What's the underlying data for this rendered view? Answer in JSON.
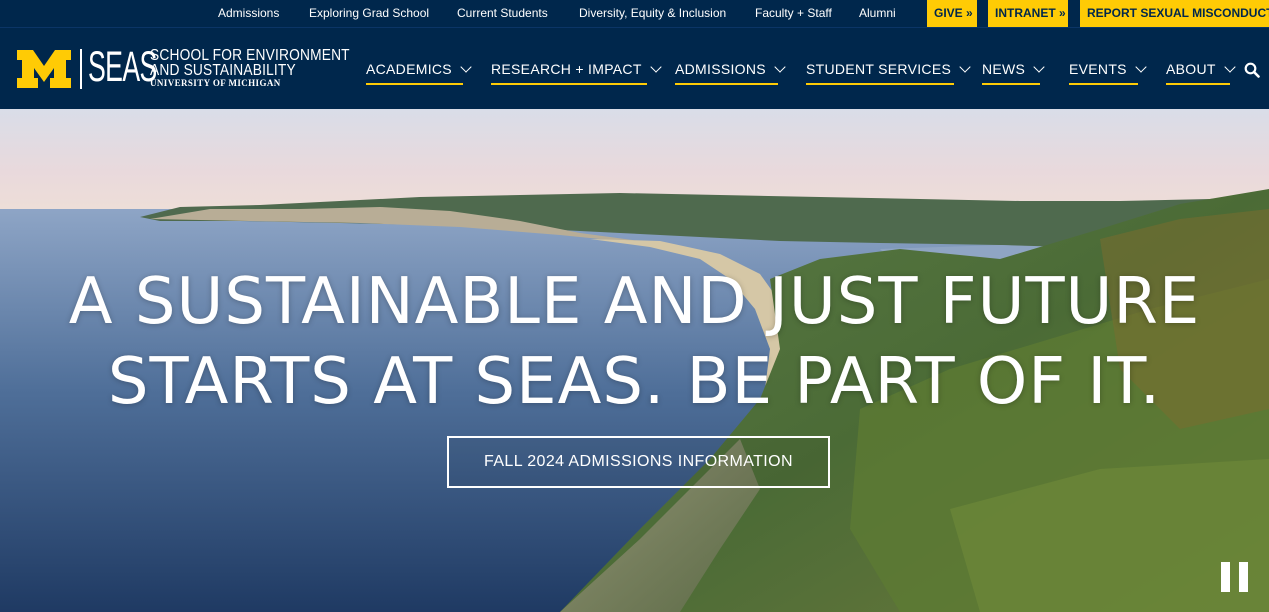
{
  "utility": {
    "links": [
      "Admissions",
      "Exploring Grad School",
      "Current Students",
      "Diversity, Equity & Inclusion",
      "Faculty + Staff",
      "Alumni"
    ],
    "give": "GIVE »",
    "intranet": "INTRANET »",
    "report": "REPORT SEXUAL MISCONDUCT »"
  },
  "logo": {
    "seas": "SEAS",
    "line1": "SCHOOL FOR ENVIRONMENT",
    "line2": "AND SUSTAINABILITY",
    "line3": "UNIVERSITY OF MICHIGAN"
  },
  "nav": {
    "items": [
      {
        "label": "ACADEMICS"
      },
      {
        "label": "RESEARCH + IMPACT"
      },
      {
        "label": "ADMISSIONS"
      },
      {
        "label": "STUDENT SERVICES"
      },
      {
        "label": "NEWS"
      },
      {
        "label": "EVENTS"
      },
      {
        "label": "ABOUT"
      }
    ],
    "search_icon": "search-icon"
  },
  "hero": {
    "title_line1": "A SUSTAINABLE AND JUST FUTURE",
    "title_line2": "STARTS AT SEAS. BE PART OF IT.",
    "cta": "FALL 2024 ADMISSIONS INFORMATION",
    "pause_icon": "pause-icon"
  },
  "colors": {
    "navy": "#00274c",
    "maize": "#ffcb05",
    "white": "#ffffff"
  }
}
